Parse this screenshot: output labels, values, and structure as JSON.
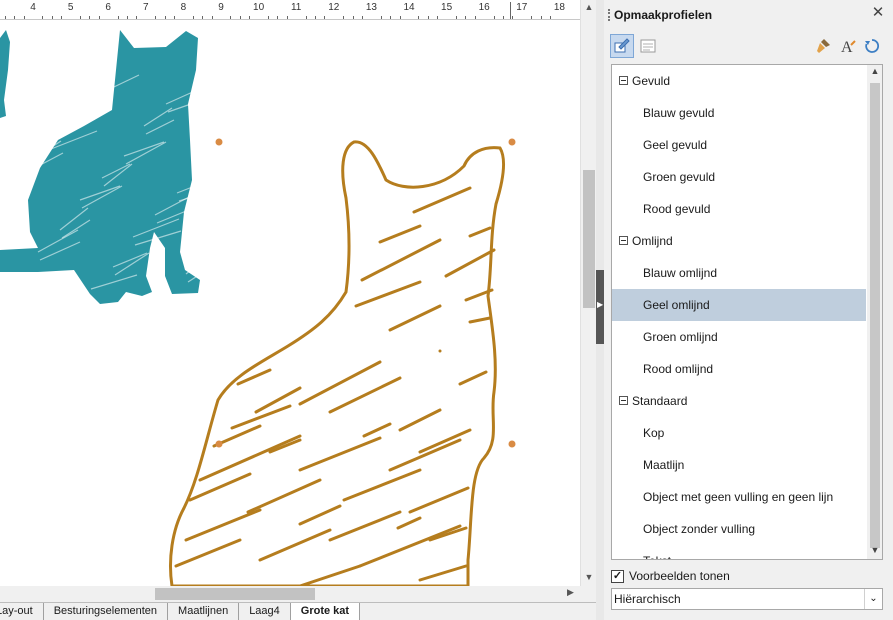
{
  "ruler": {
    "labels": [
      "4",
      "5",
      "6",
      "7",
      "8",
      "9",
      "10",
      "11",
      "12",
      "13",
      "14",
      "15",
      "16",
      "17",
      "18"
    ]
  },
  "tabs": [
    "Lay-out",
    "Besturingselementen",
    "Maatlijnen",
    "Laag4",
    "Grote kat"
  ],
  "active_tab": "Grote kat",
  "panel": {
    "title": "Opmaakprofielen",
    "toolbar": [
      {
        "icon": "paragraph-styles-icon",
        "active": true
      },
      {
        "icon": "page-styles-icon",
        "active": false
      },
      {
        "icon": "fill-format-icon",
        "active": false
      },
      {
        "icon": "new-style-icon",
        "active": false
      },
      {
        "icon": "update-style-icon",
        "active": false
      }
    ],
    "tree": [
      {
        "type": "category",
        "label": "Gevuld"
      },
      {
        "type": "item",
        "label": "Blauw gevuld"
      },
      {
        "type": "item",
        "label": "Geel gevuld"
      },
      {
        "type": "item",
        "label": "Groen gevuld"
      },
      {
        "type": "item",
        "label": "Rood gevuld"
      },
      {
        "type": "category",
        "label": "Omlijnd"
      },
      {
        "type": "item",
        "label": "Blauw omlijnd"
      },
      {
        "type": "item",
        "label": "Geel omlijnd",
        "selected": true
      },
      {
        "type": "item",
        "label": "Groen omlijnd"
      },
      {
        "type": "item",
        "label": "Rood omlijnd"
      },
      {
        "type": "category",
        "label": "Standaard"
      },
      {
        "type": "item",
        "label": "Kop"
      },
      {
        "type": "item",
        "label": "Maatlijn"
      },
      {
        "type": "item",
        "label": "Object met geen vulling en geen lijn"
      },
      {
        "type": "item",
        "label": "Object zonder vulling"
      },
      {
        "type": "item",
        "label": "Tekst"
      }
    ],
    "preview_checkbox": {
      "label": "Voorbeelden tonen",
      "checked": true
    },
    "view_select": {
      "value": "Hiërarchisch"
    }
  },
  "colors": {
    "teal_cat": "#2a95a3",
    "gold_cat": "#b57d1e",
    "handle": "#d98b44",
    "selection": "#bfcedd"
  }
}
